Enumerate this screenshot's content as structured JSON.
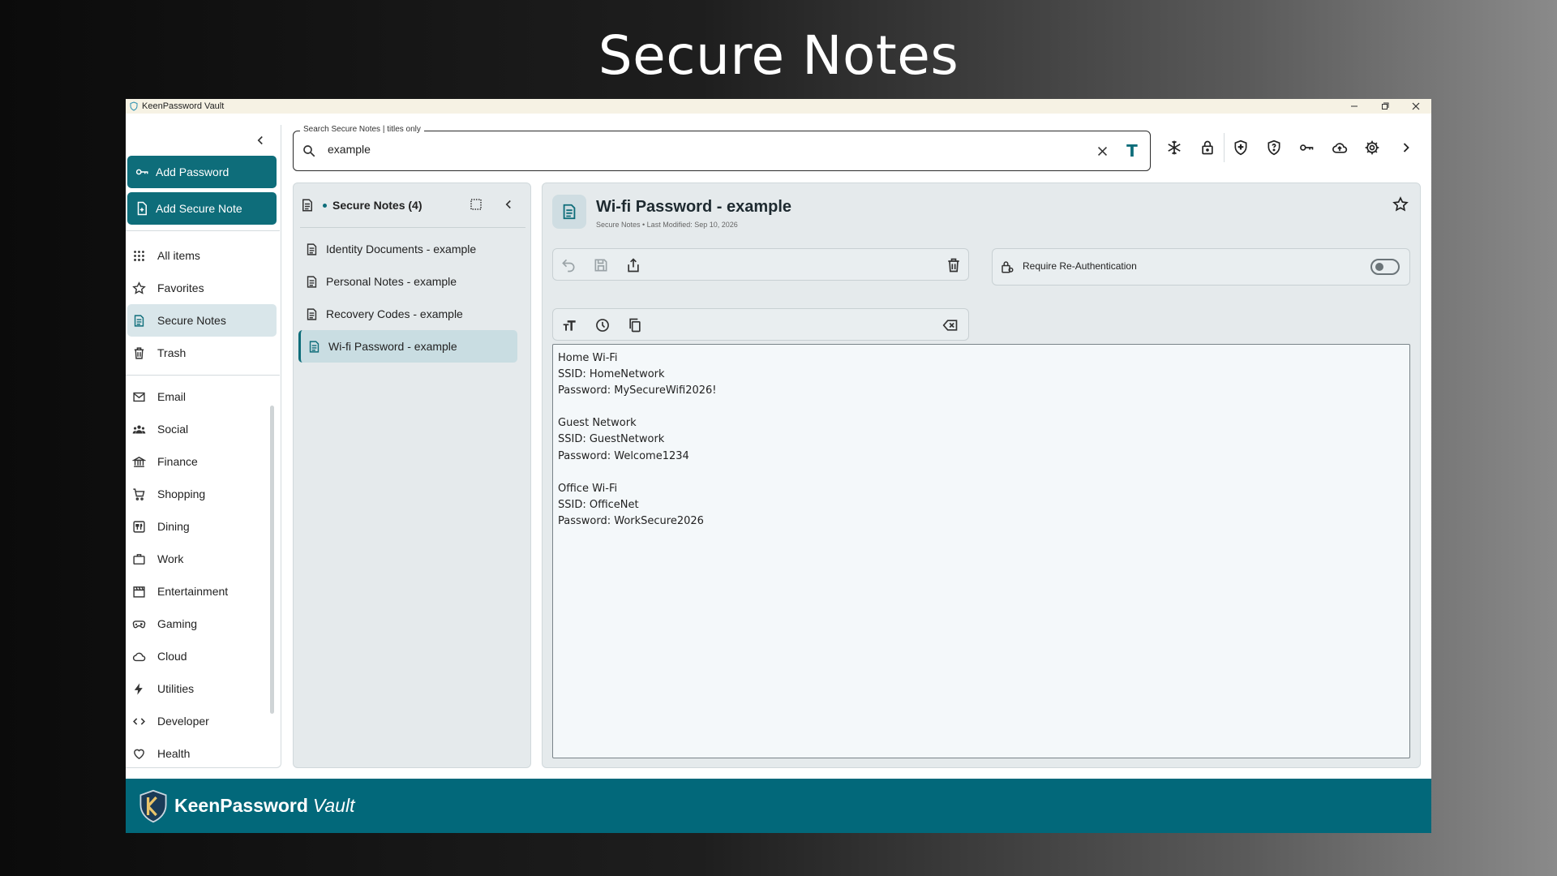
{
  "promo": {
    "title": "Secure Notes"
  },
  "window": {
    "title": "KeenPassword Vault"
  },
  "sidebar": {
    "add_password_label": "Add Password",
    "add_secure_note_label": "Add Secure Note",
    "primary_items": [
      {
        "label": "All items",
        "icon": "grid-icon"
      },
      {
        "label": "Favorites",
        "icon": "star-icon"
      },
      {
        "label": "Secure Notes",
        "icon": "note-icon",
        "active": true
      },
      {
        "label": "Trash",
        "icon": "trash-icon"
      }
    ],
    "category_items": [
      {
        "label": "Email",
        "icon": "mail-icon"
      },
      {
        "label": "Social",
        "icon": "people-icon"
      },
      {
        "label": "Finance",
        "icon": "bank-icon"
      },
      {
        "label": "Shopping",
        "icon": "cart-icon"
      },
      {
        "label": "Dining",
        "icon": "dining-icon"
      },
      {
        "label": "Work",
        "icon": "briefcase-icon"
      },
      {
        "label": "Entertainment",
        "icon": "calendar-icon"
      },
      {
        "label": "Gaming",
        "icon": "gamepad-icon"
      },
      {
        "label": "Cloud",
        "icon": "cloud-icon"
      },
      {
        "label": "Utilities",
        "icon": "bolt-icon"
      },
      {
        "label": "Developer",
        "icon": "code-icon"
      },
      {
        "label": "Health",
        "icon": "heart-icon"
      }
    ]
  },
  "search": {
    "legend": "Search Secure Notes | titles only",
    "value": "example",
    "text_mode_label": "T"
  },
  "list": {
    "header": "Secure Notes (4)",
    "items": [
      {
        "label": "Identity Documents - example"
      },
      {
        "label": "Personal Notes - example"
      },
      {
        "label": "Recovery Codes - example"
      },
      {
        "label": "Wi-fi Password - example",
        "active": true
      }
    ]
  },
  "detail": {
    "title": "Wi-fi Password - example",
    "meta": "Secure Notes • Last Modified: Sep 10, 2026",
    "reauth_label": "Require Re-Authentication",
    "reauth_enabled": false,
    "content": "Home Wi-Fi\nSSID: HomeNetwork\nPassword: MySecureWifi2026!\n\nGuest Network\nSSID: GuestNetwork\nPassword: Welcome1234\n\nOffice Wi-Fi\nSSID: OfficeNet\nPassword: WorkSecure2026"
  },
  "footer": {
    "brand": "KeenPassword",
    "brand_suffix": "Vault"
  },
  "colors": {
    "accent": "#0e6d7a",
    "footer": "#02687a",
    "active_bg": "#d9e6ea"
  }
}
